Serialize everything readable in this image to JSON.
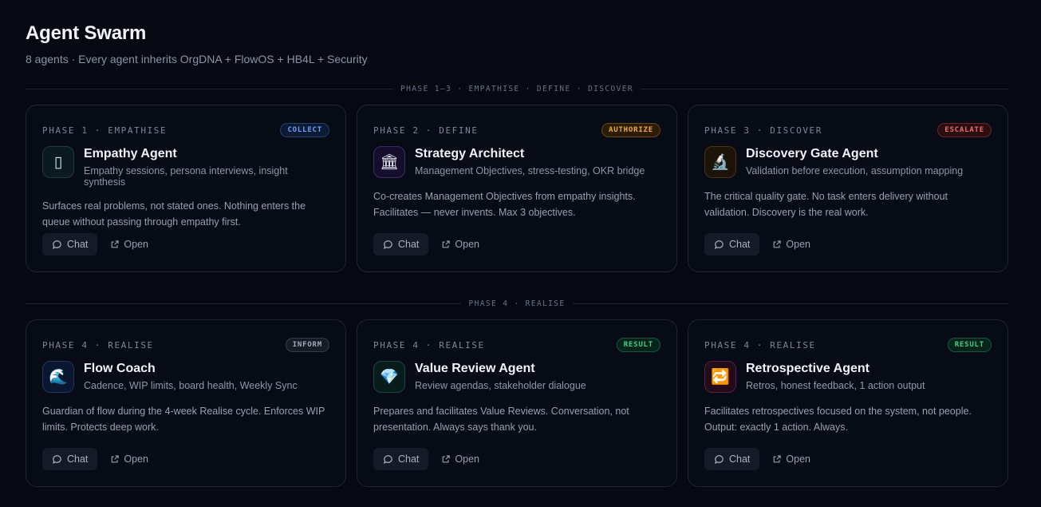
{
  "page": {
    "title": "Agent Swarm",
    "subtitle": "8 agents · Every agent inherits OrgDNA + FlowOS + HB4L + Security"
  },
  "sections": [
    {
      "label": "PHASE 1–3 · EMPATHISE · DEFINE · DISCOVER",
      "cards": [
        {
          "phase": "PHASE 1 · EMPATHISE",
          "badge": "COLLECT",
          "badge_color": "#6aa2ff",
          "icon": "empathy-icon",
          "icon_glyph": "▯",
          "name": "Empathy Agent",
          "tagline": "Empathy sessions, persona interviews, insight synthesis",
          "description": "Surfaces real problems, not stated ones. Nothing enters the queue without passing through empathy first.",
          "chat_label": "Chat",
          "open_label": "Open"
        },
        {
          "phase": "PHASE 2 · DEFINE",
          "badge": "AUTHORIZE",
          "badge_color": "#f2a93b",
          "icon": "classical-building-icon",
          "icon_glyph": "🏛",
          "name": "Strategy Architect",
          "tagline": "Management Objectives, stress-testing, OKR bridge",
          "description": "Co-creates Management Objectives from empathy insights. Facilitates — never invents. Max 3 objectives.",
          "chat_label": "Chat",
          "open_label": "Open"
        },
        {
          "phase": "PHASE 3 · DISCOVER",
          "badge": "ESCALATE",
          "badge_color": "#f06b6b",
          "icon": "microscope-icon",
          "icon_glyph": "🔬",
          "name": "Discovery Gate Agent",
          "tagline": "Validation before execution, assumption mapping",
          "description": "The critical quality gate. No task enters delivery without validation. Discovery is the real work.",
          "chat_label": "Chat",
          "open_label": "Open"
        }
      ]
    },
    {
      "label": "PHASE 4 · REALISE",
      "cards": [
        {
          "phase": "PHASE 4 · REALISE",
          "badge": "INFORM",
          "badge_color": "#a2aabd",
          "icon": "wave-icon",
          "icon_glyph": "🌊",
          "name": "Flow Coach",
          "tagline": "Cadence, WIP limits, board health, Weekly Sync",
          "description": "Guardian of flow during the 4-week Realise cycle. Enforces WIP limits. Protects deep work.",
          "chat_label": "Chat",
          "open_label": "Open"
        },
        {
          "phase": "PHASE 4 · REALISE",
          "badge": "RESULT",
          "badge_color": "#3fd086",
          "icon": "gem-icon",
          "icon_glyph": "💎",
          "name": "Value Review Agent",
          "tagline": "Review agendas, stakeholder dialogue",
          "description": "Prepares and facilitates Value Reviews. Conversation, not presentation. Always says thank you.",
          "chat_label": "Chat",
          "open_label": "Open"
        },
        {
          "phase": "PHASE 4 · REALISE",
          "badge": "RESULT",
          "badge_color": "#3fd086",
          "icon": "repeat-icon",
          "icon_glyph": "🔁",
          "name": "Retrospective Agent",
          "tagline": "Retros, honest feedback, 1 action output",
          "description": "Facilitates retrospectives focused on the system, not people. Output: exactly 1 action. Always.",
          "chat_label": "Chat",
          "open_label": "Open"
        }
      ]
    }
  ]
}
